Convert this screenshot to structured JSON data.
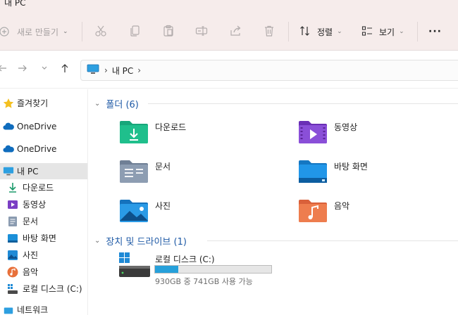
{
  "window": {
    "title": "내 PC"
  },
  "toolbar": {
    "new_label": "새로 만들기",
    "sort_label": "정렬",
    "view_label": "보기",
    "more_label": "···",
    "icons": [
      "plus-icon",
      "cut-icon",
      "copy-icon",
      "paste-icon",
      "rename-icon",
      "share-icon",
      "delete-icon",
      "sort-icon",
      "view-icon",
      "more-icon"
    ]
  },
  "address": {
    "crumbs": [
      "내 PC"
    ]
  },
  "sidebar": {
    "items": [
      {
        "label": "즐겨찾기",
        "icon": "star-icon"
      },
      {
        "label": "OneDrive",
        "icon": "cloud-icon"
      },
      {
        "label": "OneDrive",
        "icon": "cloud-icon"
      },
      {
        "label": "내 PC",
        "icon": "monitor-icon",
        "selected": true
      },
      {
        "label": "다운로드",
        "icon": "download-icon"
      },
      {
        "label": "동영상",
        "icon": "video-icon"
      },
      {
        "label": "문서",
        "icon": "document-icon"
      },
      {
        "label": "바탕 화면",
        "icon": "desktop-icon"
      },
      {
        "label": "사진",
        "icon": "picture-icon"
      },
      {
        "label": "음악",
        "icon": "music-icon"
      },
      {
        "label": "로컬 디스크 (C:)",
        "icon": "drive-icon"
      },
      {
        "label": "네트워크",
        "icon": "network-icon"
      }
    ]
  },
  "folders": {
    "title": "폴더 (6)",
    "items": [
      {
        "label": "다운로드",
        "icon": "download-folder-icon"
      },
      {
        "label": "동영상",
        "icon": "video-folder-icon"
      },
      {
        "label": "문서",
        "icon": "document-folder-icon"
      },
      {
        "label": "바탕 화면",
        "icon": "desktop-folder-icon"
      },
      {
        "label": "사진",
        "icon": "picture-folder-icon"
      },
      {
        "label": "음악",
        "icon": "music-folder-icon"
      }
    ]
  },
  "devices": {
    "title": "장치 및 드라이브 (1)",
    "drive": {
      "name": "로컬 디스크 (C:)",
      "free_text": "930GB 중 741GB 사용 가능",
      "used_fraction": 0.2,
      "icon": "hard-drive-icon"
    }
  },
  "colors": {
    "accent": "#1f5aa6",
    "toolbar_bg": "#f6eceb",
    "drive_fill": "#26a0da",
    "selected_bg": "#e5e5e5"
  }
}
